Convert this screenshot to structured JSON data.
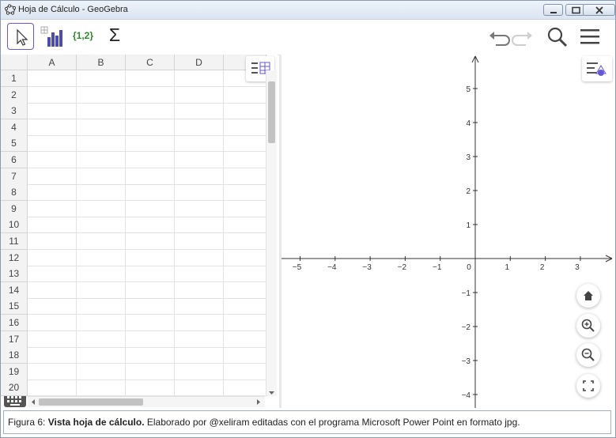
{
  "window": {
    "title": "Hoja de Cálculo - GeoGebra",
    "controls": [
      "minimize-icon",
      "maximize-icon",
      "close-icon"
    ]
  },
  "toolbar": {
    "tools": [
      {
        "name": "move-tool",
        "icon": "cursor-arrow-icon",
        "active": true
      },
      {
        "name": "two-variable-analysis-tool",
        "icon": "bar-chart-icon"
      },
      {
        "name": "create-list-tool",
        "label": "{1,2}"
      },
      {
        "name": "sum-tool",
        "label": "Σ"
      }
    ],
    "right_tools": [
      "undo-icon",
      "redo-icon",
      "search-icon",
      "menu-icon"
    ]
  },
  "spreadsheet": {
    "columns": [
      "A",
      "B",
      "C",
      "D"
    ],
    "rows": [
      "1",
      "2",
      "3",
      "4",
      "5",
      "6",
      "7",
      "8",
      "9",
      "10",
      "11",
      "12",
      "13",
      "14",
      "15",
      "16",
      "17",
      "18",
      "19",
      "20"
    ]
  },
  "graphics": {
    "x_ticks": [
      "−5",
      "−4",
      "−3",
      "−2",
      "−1",
      "0",
      "1",
      "2",
      "3"
    ],
    "y_ticks_pos": [
      "5",
      "4",
      "3",
      "2",
      "1"
    ],
    "y_ticks_neg": [
      "−1",
      "−2",
      "−3",
      "−4"
    ],
    "buttons": [
      "home-icon",
      "zoom-in-icon",
      "zoom-out-icon",
      "fullscreen-icon"
    ]
  },
  "caption": {
    "prefix": "Figura 6: ",
    "bold": "Vista hoja de cálculo.",
    "rest": " Elaborado por @xeliram editadas con el programa Microsoft Power Point en formato jpg."
  },
  "colors": {
    "accent": "#6557d2",
    "titlebar": "#dbe5f1",
    "axes": "#333333"
  }
}
